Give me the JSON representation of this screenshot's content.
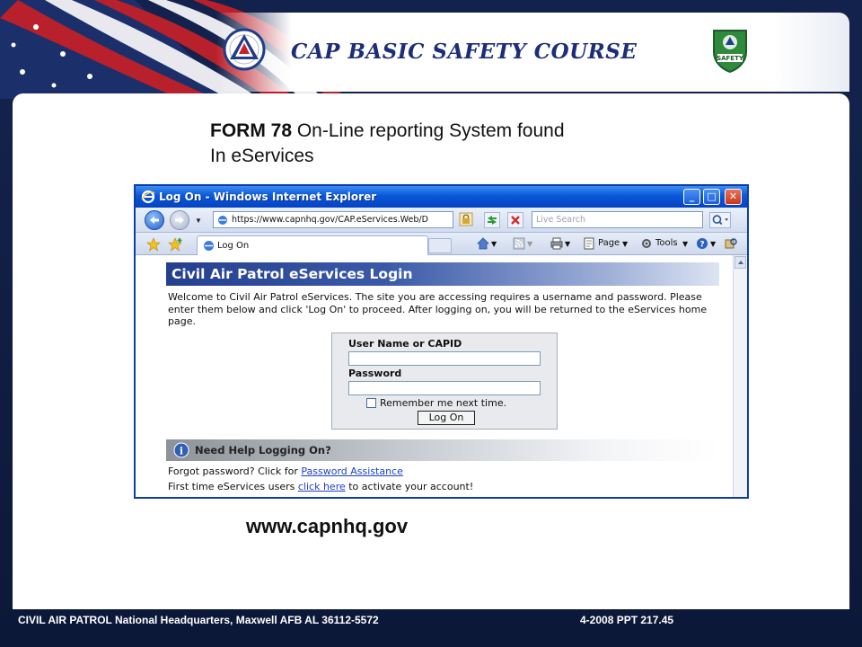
{
  "slide": {
    "title": "CAP BASIC SAFETY COURSE",
    "heading_bold": "FORM 78",
    "heading_rest": " On-Line reporting System found",
    "heading_line2": "In eServices",
    "url": "www.capnhq.gov",
    "footer_left": "CIVIL AIR PATROL National Headquarters, Maxwell AFB AL 36112-5572",
    "footer_right": "4-2008 PPT 217.45",
    "left_logo_icon": "civil-air-patrol-emblem-icon",
    "right_logo_icon": "safety-shield-icon",
    "safety_logo_text": "SAFETY"
  },
  "browser": {
    "title": "Log On - Windows Internet Explorer",
    "min_label": "_",
    "max_label": "□",
    "close_label": "✕",
    "address": "https://www.capnhq.gov/CAP.eServices.Web/D",
    "search_placeholder": "Live Search",
    "tab_label": "Log On",
    "toolbar": {
      "page_label": "Page",
      "tools_label": "Tools"
    }
  },
  "login": {
    "header": "Civil Air Patrol eServices Login",
    "welcome": "Welcome to Civil Air Patrol eServices.  The site you are accessing requires a username and password.  Please enter them below and click 'Log On' to proceed. After logging on, you will be returned to the eServices home page.",
    "username_label": "User Name or CAPID",
    "password_label": "Password",
    "remember_label": "Remember me next time.",
    "logon_button": "Log On",
    "help_header": "Need Help Logging On?",
    "help1_prefix": "Forgot password? Click for ",
    "help1_link": "Password Assistance",
    "help2_prefix": "First time eServices users ",
    "help2_link": "click here",
    "help2_suffix": " to activate your account!"
  },
  "colors": {
    "title_blue": "#1c2d7a",
    "slide_navy": "#0c1838",
    "ie_titlebar": "#0a58d8",
    "login_header": "#253f8f",
    "link_blue": "#1a3fd0"
  }
}
